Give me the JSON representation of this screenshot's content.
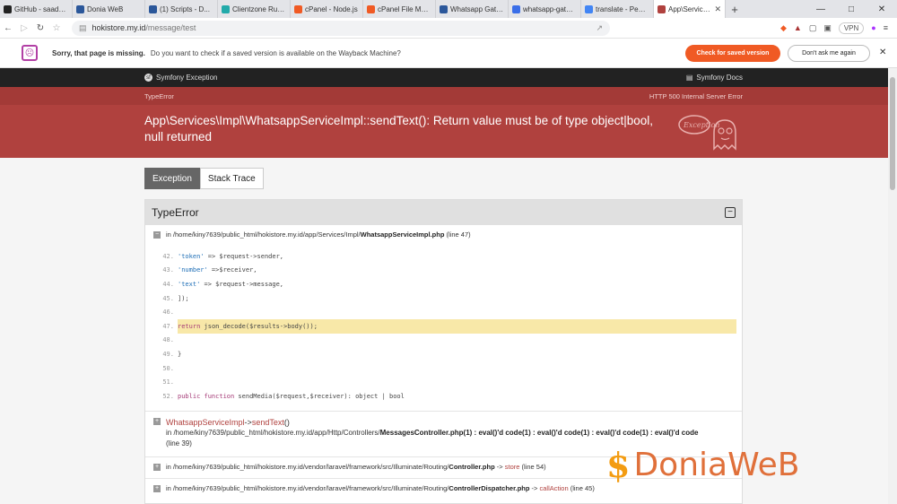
{
  "tabs": [
    {
      "title": "GitHub - saadq/...",
      "color": "#222"
    },
    {
      "title": "Donia WeB",
      "color": "#2b579a"
    },
    {
      "title": "(1) Scripts - D...",
      "color": "#2b579a"
    },
    {
      "title": "Clientzone Ruma...",
      "color": "#2aa"
    },
    {
      "title": "cPanel - Node.js",
      "color": "#f05a24"
    },
    {
      "title": "cPanel File Mana...",
      "color": "#f05a24"
    },
    {
      "title": "Whatsapp Gatew...",
      "color": "#2b579a"
    },
    {
      "title": "whatsapp-gatew...",
      "color": "#3a6ee8"
    },
    {
      "title": "translate - Penel...",
      "color": "#4285f4"
    },
    {
      "title": "App\\Service...",
      "color": "#b0413e",
      "active": true
    }
  ],
  "url": {
    "host": "hokistore.my.id",
    "path": "/message/test"
  },
  "vpn_label": "VPN",
  "wayback": {
    "title": "Sorry, that page is missing.",
    "desc": "Do you want to check if a saved version is available on the Wayback Machine?",
    "check": "Check for saved version",
    "dont": "Don't ask me again"
  },
  "symfony": {
    "exception_label": "Symfony Exception",
    "docs_label": "Symfony Docs",
    "type": "TypeError",
    "http_status": "HTTP 500 Internal Server Error",
    "message": "App\\Services\\Impl\\WhatsappServiceImpl::sendText(): Return value must be of type object|bool, null returned",
    "tab_exception": "Exception",
    "tab_trace": "Stack Trace",
    "panel_title": "TypeError",
    "frame1": {
      "prefix": "in /home/kiny7639/public_html/hokistore.my.id/app/Services/Impl/",
      "file": "WhatsappServiceImpl.php",
      "line": "(line 47)"
    },
    "code_lines": [
      {
        "n": "42.",
        "hl": false
      },
      {
        "n": "43.",
        "hl": false
      },
      {
        "n": "44.",
        "hl": false
      },
      {
        "n": "45.",
        "hl": false
      },
      {
        "n": "46.",
        "hl": false
      },
      {
        "n": "47.",
        "hl": true
      },
      {
        "n": "48.",
        "hl": false
      },
      {
        "n": "49.",
        "hl": false
      },
      {
        "n": "50.",
        "hl": false
      },
      {
        "n": "51.",
        "hl": false
      },
      {
        "n": "52.",
        "hl": false
      }
    ],
    "code_text": {
      "l42a": "'token'",
      "l42b": " => $request->sender,",
      "l43a": "'number'",
      "l43b": " =>$receiver,",
      "l44a": "'text'",
      "l44b": " => $request->message,",
      "l45": "]);",
      "l47a": "return",
      "l47b": " json_decode($results->body());",
      "l49": "}",
      "l52a": "public function",
      "l52b": " sendMedia($request,$receiver): object | bool"
    },
    "frame2": {
      "cls": "WhatsappServiceImpl",
      "arrow": "->",
      "method": "sendText",
      "paren": "()",
      "path_prefix": "in /home/kiny7639/public_html/hokistore.my.id/app/Http/Controllers/",
      "file": "MessagesController.php(1) : eval()'d code(1) : eval()'d code(1) : eval()'d code(1) : eval()'d code",
      "line": "(line 39)"
    },
    "frame3": {
      "prefix": "in /home/kiny7639/public_html/hokistore.my.id/vendor/laravel/framework/src/Illuminate/Routing/",
      "file": "Controller.php",
      "arrow": "->",
      "method": "store",
      "line": "(line 54)"
    },
    "frame4": {
      "prefix": "in /home/kiny7639/public_html/hokistore.my.id/vendor/laravel/framework/src/Illuminate/Routing/",
      "file": "ControllerDispatcher.php",
      "arrow": "->",
      "method": "callAction",
      "line": "(line 45)"
    }
  },
  "watermark": {
    "symbol": "$",
    "text": "DoniaWeB"
  }
}
